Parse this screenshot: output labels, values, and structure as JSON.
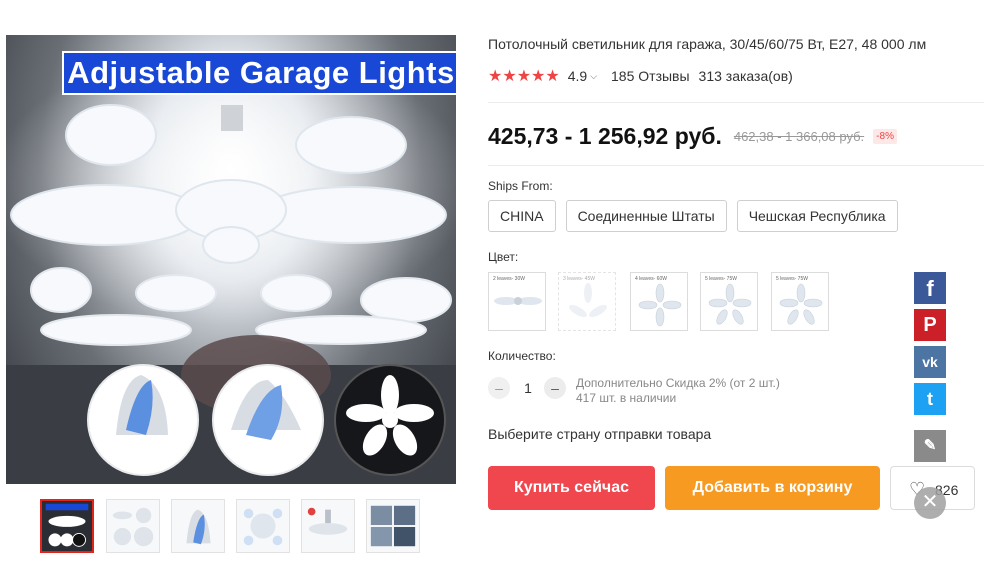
{
  "gallery": {
    "banner_text": "Adjustable Garage Lights",
    "thumbnails": [
      {
        "name": "thumb-main",
        "active": true
      },
      {
        "name": "thumb-variants",
        "active": false
      },
      {
        "name": "thumb-folded",
        "active": false
      },
      {
        "name": "thumb-details",
        "active": false
      },
      {
        "name": "thumb-install",
        "active": false
      },
      {
        "name": "thumb-scenes",
        "active": false
      }
    ]
  },
  "product": {
    "title": "Потолочный светильник для гаража, 30/45/60/75 Вт, E27, 48 000 лм",
    "stars": "★★★★★",
    "rating": "4.9",
    "rating_caret": "⌵",
    "reviews": "185 Отзывы",
    "orders": "313 заказа(ов)",
    "price": "425,73 - 1 256,92 руб.",
    "old_price": "462,38 - 1 366,08 руб.",
    "discount": "-8%"
  },
  "shipping": {
    "label": "Ships From:",
    "options": [
      "CHINA",
      "Соединенные Штаты",
      "Чешская Республика"
    ],
    "country_prompt": "Выберите страну отправки товара"
  },
  "color": {
    "label": "Цвет:",
    "swatches": [
      {
        "caption": "2 leaves- 30W",
        "available": true
      },
      {
        "caption": "3 leaves- 45W",
        "available": false
      },
      {
        "caption": "4 leaves- 60W",
        "available": true
      },
      {
        "caption": "5 leaves- 75W",
        "available": true
      },
      {
        "caption": "5 leaves- 75W",
        "available": true
      }
    ]
  },
  "quantity": {
    "label": "Количество:",
    "value": "1",
    "minus": "–",
    "plus": "–",
    "discount_note": "Дополнительно Скидка 2% (от 2 шт.)",
    "stock": "417 шт. в наличии"
  },
  "actions": {
    "buy_now": "Купить сейчас",
    "add_to_cart": "Добавить в корзину",
    "wishlist_count": "826",
    "heart": "♡",
    "close": "✕"
  },
  "social": {
    "facebook": "f",
    "pinterest": "P",
    "vk": "vk",
    "twitter": "t",
    "edit": "✎"
  },
  "colors": {
    "buy_button": "#f0474e",
    "cart_button": "#f79a21",
    "stars": "#f04444",
    "banner": "#1947d6",
    "facebook": "#3b5998",
    "pinterest": "#cb2027",
    "vk": "#4c75a3",
    "twitter": "#1da1f2"
  }
}
